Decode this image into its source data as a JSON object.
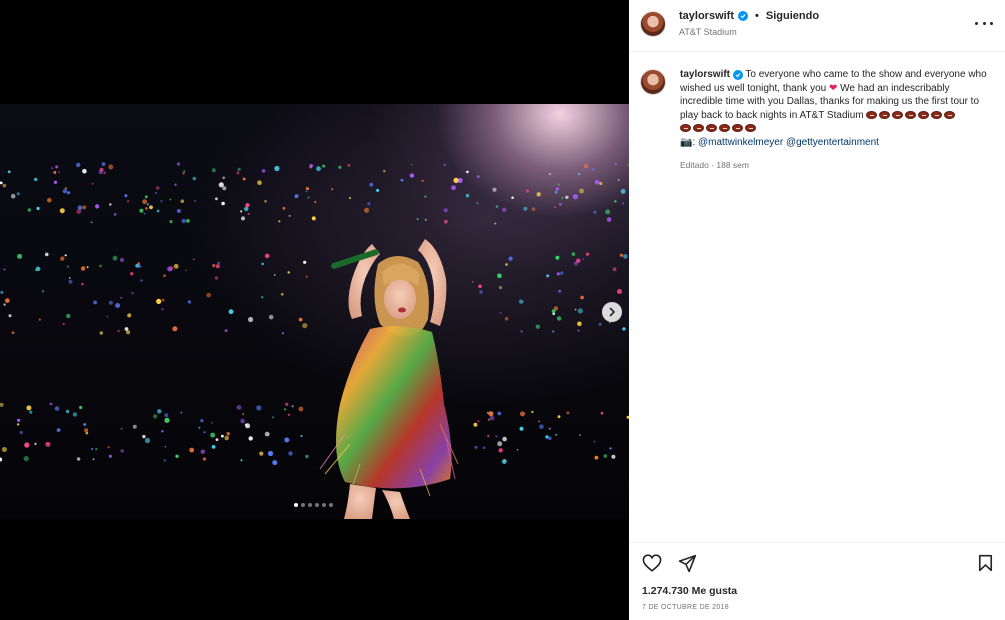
{
  "post": {
    "username": "taylorswift",
    "separator": "•",
    "follow_status": "Siguiendo",
    "location": "AT&T Stadium",
    "caption": {
      "text_1": "To everyone who came to the show and everyone who wished us well tonight, thank you",
      "text_2": "We had an indescribably incredible time with you Dallas, thanks for making us the first tour to play back to back nights in AT&T Stadium",
      "camera_sep": ":",
      "mention_1": "@mattwinkelmeyer",
      "mention_2": "@gettyentertainment",
      "football_count_line1": 7,
      "football_count_line2": 6
    },
    "meta": "Editado · 188 sem",
    "likes": "1.274.730 Me gusta",
    "date": "7 DE OCTUBRE DE 2018",
    "carousel": {
      "count": 6,
      "active_index": 0
    }
  },
  "icons": {
    "heart": "heart-icon",
    "share": "share-icon",
    "save": "bookmark-icon",
    "more": "more-options-icon",
    "next": "chevron-right-icon",
    "verified": "verified-badge-icon"
  },
  "colors": {
    "verified": "#0095f6",
    "mention": "#00376b",
    "secondary_text": "#737373",
    "heart_emoji": "#e0245e"
  }
}
